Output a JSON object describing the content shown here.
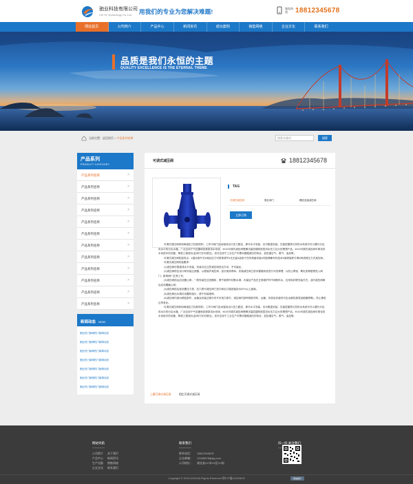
{
  "header": {
    "company": "驰业科技有限公司",
    "company_sub": "Chi Ye Technology Co.,Ltd",
    "slogan": "用我们的专业为您解决难题!",
    "phone_label": "服务热线",
    "phone": "18812345678"
  },
  "nav": {
    "items": [
      "网站首页",
      "公司简介",
      "产品中心",
      "新闻资讯",
      "成功案例",
      "销售网络",
      "企业文化",
      "联系我们"
    ]
  },
  "banner": {
    "title": "品质是我们永恒的主题",
    "subtitle": "QUALITY EXCELLENCE IS THE ETERNAL THEME"
  },
  "breadcrumb": {
    "prefix": "当前位置：",
    "home": "返回首页",
    "sep": " > ",
    "current": "产品系列名称"
  },
  "search": {
    "placeholder": "搜索关键词",
    "button": "搜索"
  },
  "sidebar": {
    "title": "产品系列",
    "subtitle": "PRODUCT CATEGORY",
    "items": [
      "产品系列名称",
      "产品系列名称",
      "产品系列名称",
      "产品系列名称",
      "产品系列名称",
      "产品系列名称",
      "产品系列名称",
      "产品系列名称",
      "产品系列名称",
      "产品系列名称",
      "产品系列名称",
      "产品系列名称"
    ],
    "active_index": 0,
    "news_title": "新闻动态",
    "news_subtitle": "NEWS",
    "news": [
      "驰业热门新闻热门新闻动态",
      "驰业热门新闻热门新闻动态",
      "驰业热门新闻热门新闻动态",
      "驰业热门新闻热门新闻动态",
      "驰业热门新闻热门新闻动态",
      "驰业热门新闻热门新闻动态",
      "驰业热门新闻热门新闻动态"
    ]
  },
  "product": {
    "title": "可调式减压阀",
    "phone": "18812345678",
    "tag": "TAG",
    "spec_a": "可调式减压阀",
    "spec_b": "驰业阀门",
    "spec_c": "螺纹连接减压阀",
    "cta": "立即订购",
    "body": [
      "可调式减压阀采用阀组压力控制机构，工作中阀门自动保持出口压力稳定，即可水平安装，也可垂直安装，在高层建筑与热供水系统中可以替代分区供水中的分区水箱，广泛应用于气压罐和变频泵供水系统，¥416可调式减压阀是解决高层建筑底层供水压力过大的理想产品。¥416可调式减压阀可简化供水系统中的设备，降低工程造价(此阀门仅可超压)，还可应用于工业生产中需对管路减压的场合，如压缩空气、蒸气、油品等。",
      "可调式减压阀性能特点：●直动常开式●阀后压力可现场调节●无无量●适用于任何角度安装●内胆弹簧专利技术●维修保养方便●阀滤阀压力式减压阀。",
      "可调式减压阀安装要求：",
      "(1)减压阀可垂直或水平安装，安装中应注意减压阀进出方向，不可装反。",
      "(2)减压阀前应设计和安装过滤器，以便保护减压阀，延长使用寿命。安装减压阀之前对管路系统进行冲洗清理，以防止焊渣、氧化皮等脏物进入阀门，影响阀门正常工作。",
      "(3)减压阀前后应设置止阀，一般安装在过滤器前，便于维修时切断水源。为保证产品在正常维护时不间断供水，应采用并联安装方式，此时减压阀两后应设置截止阀。",
      "(4)减压阀前后宜设置压力表，压力表可减压阀门进口和出口端宜保持为50%以上距离。",
      "(5)减压阀出水端可设置软接头，便于安装维修。",
      "(6)减压阀内部为精密部件，运输及安装过程中切不可用力摔打，减压阀内部有橡胶材料，运输、存放及安装时可应远离热源或加稳器物等)，防止橡胶过早老化。",
      "可调式减压阀采用阀组压力控制机构，工作中阀门自动保持出口压力稳定，即可水平安装，也可垂直安装，在高层建筑与热供水系统中可以替代分区供水中的分区水箱，广泛应用于气压罐和变频泵供水系统，¥416可调式减压阀是解决高层建筑底层供水压力过大的理想产品。¥416可调式减压阀可简化供水系统中的设备，降低工程造价(此阀门仅可超压)，还可应用于工业生产中需对管路减压的场合，如压缩空气、蒸气、油品等。"
    ],
    "related_a": "上篇可调式减压阀",
    "related_b": "相比可调式减压阀"
  },
  "footer": {
    "nav_title": "网站导航",
    "nav_rows": [
      [
        "公司简介",
        "关于我们"
      ],
      [
        "产品中心",
        "新闻资讯"
      ],
      [
        "生产设备",
        "销售网络"
      ],
      [
        "企业文化",
        "联系我们"
      ]
    ],
    "contact_title": "联系我们",
    "contact_rows": [
      [
        "联系电话：",
        "18812345678"
      ],
      [
        "企业邮箱：",
        "12345678@qq.com"
      ],
      [
        "公司地址：",
        "湖北省XX市XX区XX街"
      ]
    ],
    "qr_title": "扫一扫 关注我们",
    "copyright": "Copyright © 2019-2018 All Rights Reserved 鄂ICP备12345678",
    "badge": "建站统计"
  },
  "colors": {
    "primary": "#1c78c8",
    "accent": "#e8702a",
    "footer_bg": "#3b3b3b"
  }
}
